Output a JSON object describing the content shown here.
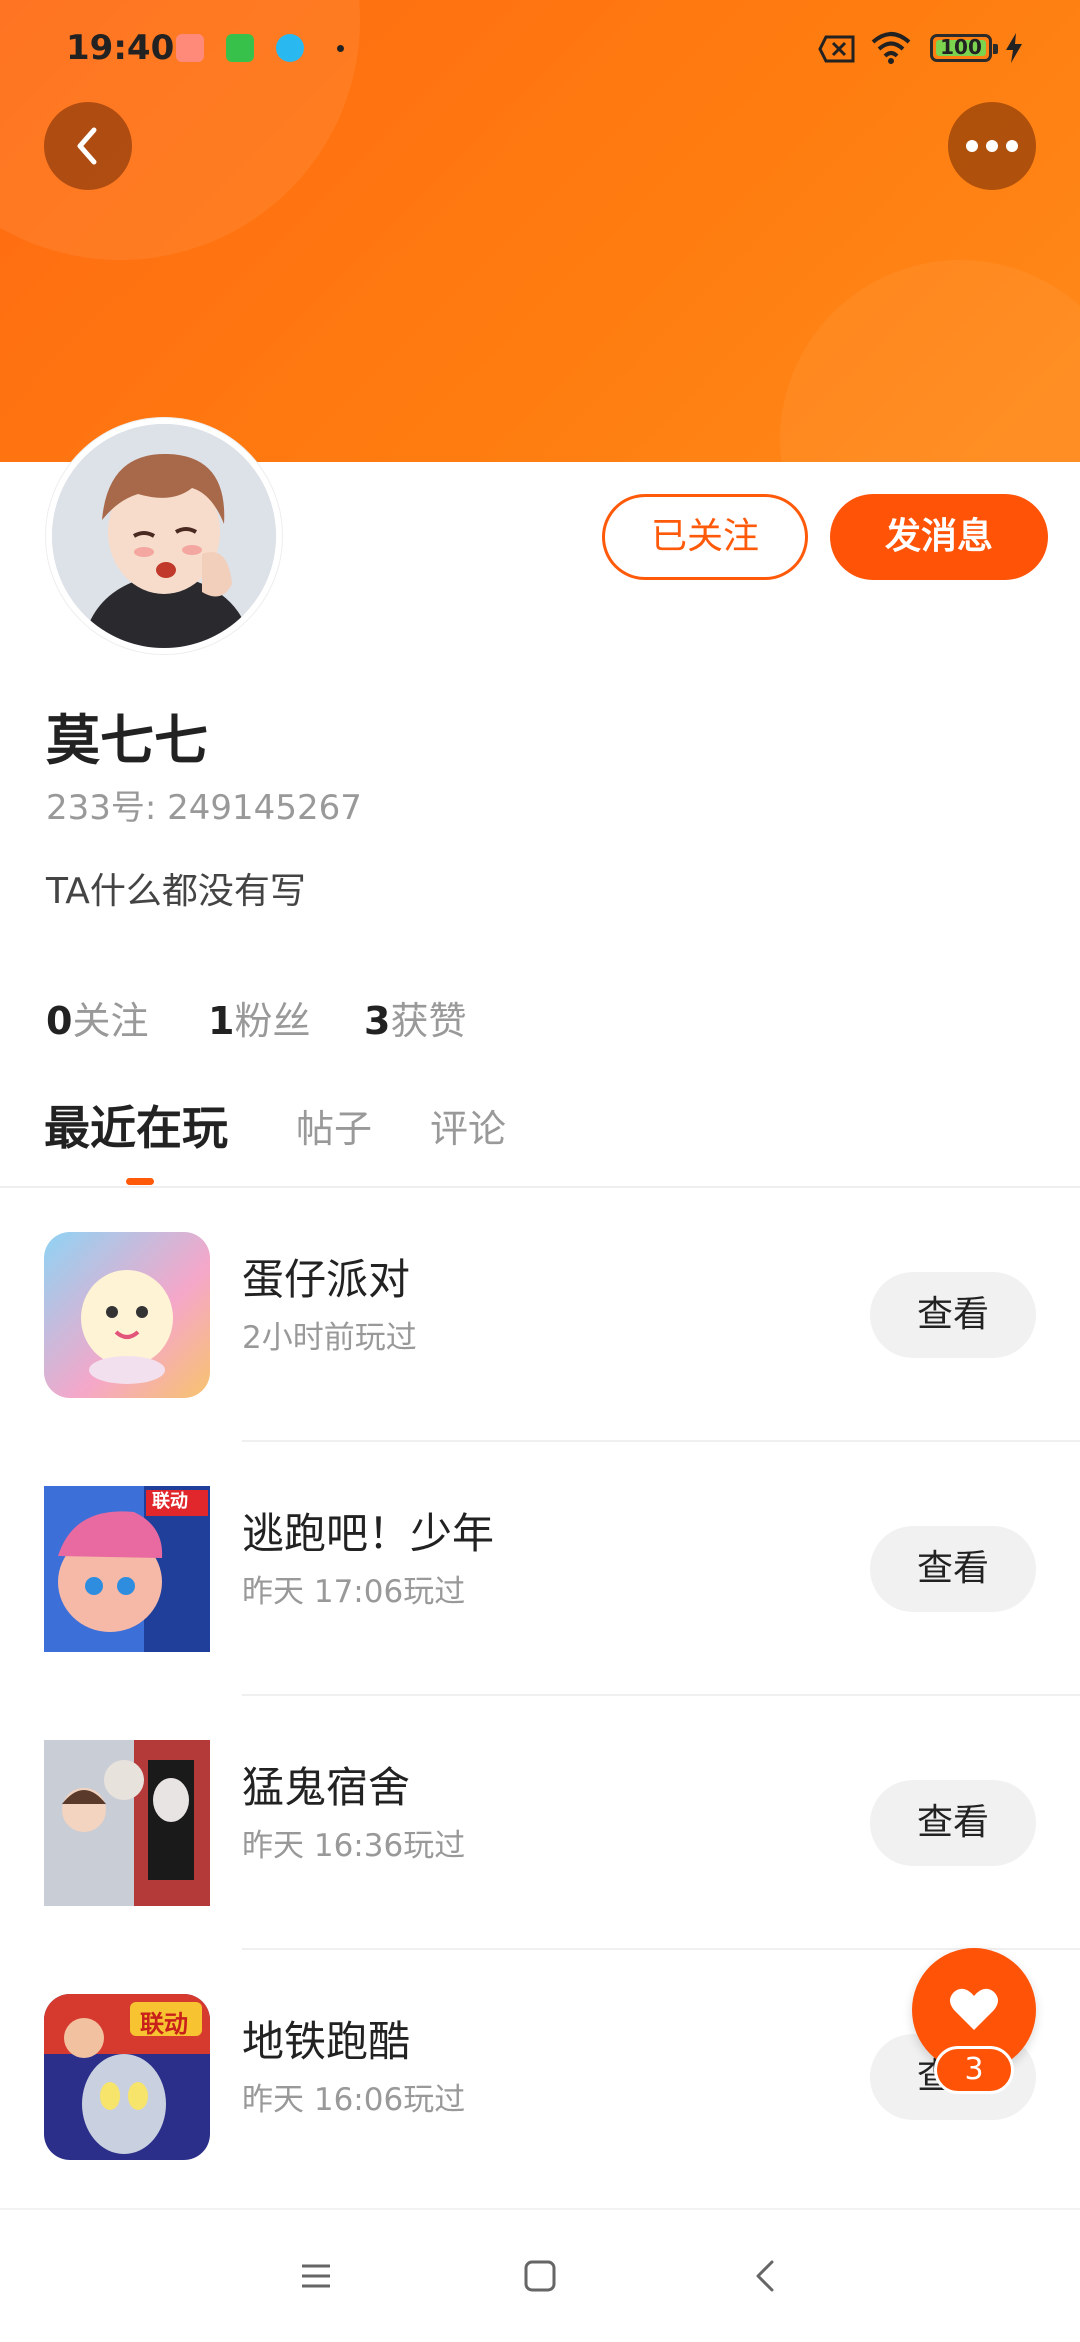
{
  "status_bar": {
    "time": "19:40",
    "battery": "100",
    "icons": [
      "app-notification-icon",
      "wechat-icon",
      "app-icon",
      "sim-off-icon",
      "wifi-icon",
      "battery-icon",
      "charging-icon"
    ]
  },
  "profile": {
    "name": "莫七七",
    "uid": "233号: 249145267",
    "bio": "TA什么都没有写",
    "follow_label": "已关注",
    "message_label": "发消息",
    "stats": [
      {
        "num": "0",
        "label": "关注"
      },
      {
        "num": "1",
        "label": "粉丝"
      },
      {
        "num": "3",
        "label": "获赞"
      }
    ]
  },
  "tabs": [
    {
      "label": "最近在玩",
      "active": true
    },
    {
      "label": "帖子",
      "active": false
    },
    {
      "label": "评论",
      "active": false
    }
  ],
  "games": [
    {
      "title": "蛋仔派对",
      "time": "2小时前玩过",
      "button": "查看"
    },
    {
      "title": "逃跑吧！少年",
      "time": "昨天 17:06玩过",
      "button": "查看",
      "tag": "联动"
    },
    {
      "title": "猛鬼宿舍",
      "time": "昨天 16:36玩过",
      "button": "查看"
    },
    {
      "title": "地铁跑酷",
      "time": "昨天 16:06玩过",
      "button": "查看",
      "tag": "联动"
    }
  ],
  "fab": {
    "count": "3"
  },
  "colors": {
    "accent": "#ff5308",
    "header": "#ff7412"
  }
}
